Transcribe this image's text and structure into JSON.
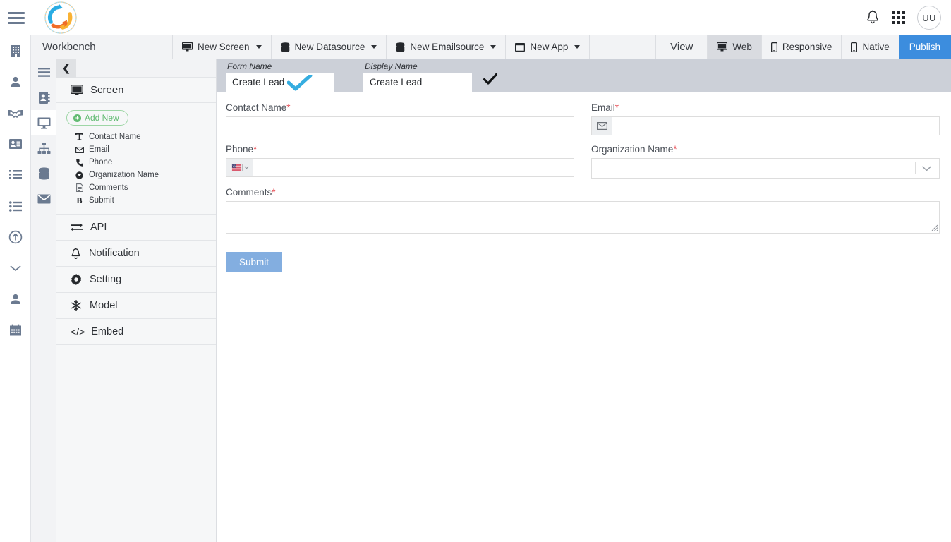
{
  "header": {
    "menu_icon": "hamburger-icon",
    "logo_icon": "sync-refresh-logo",
    "notifications_icon": "bell-icon",
    "apps_icon": "app-grid-icon",
    "avatar_initials": "UU"
  },
  "app_rail": {
    "items": [
      {
        "icon": "building-icon",
        "name": "organizations"
      },
      {
        "icon": "user-icon",
        "name": "contacts"
      },
      {
        "icon": "handshake-icon",
        "name": "deals"
      },
      {
        "icon": "id-card-icon",
        "name": "leads"
      },
      {
        "icon": "list-detail-icon",
        "name": "activities"
      },
      {
        "icon": "list-bullet-icon",
        "name": "tasks"
      },
      {
        "icon": "upload-circle-icon",
        "name": "upload"
      },
      {
        "icon": "chevron-down-icon",
        "name": "more"
      },
      {
        "icon": "user-solid-icon",
        "name": "profile"
      },
      {
        "icon": "calendar-icon",
        "name": "calendar"
      }
    ]
  },
  "tool_rail": {
    "items": [
      {
        "icon": "hamburger-icon",
        "name": "menu",
        "active": false
      },
      {
        "icon": "address-book-icon",
        "name": "contacts-source",
        "active": false
      },
      {
        "icon": "monitor-icon",
        "name": "screen",
        "active": true
      },
      {
        "icon": "sitemap-icon",
        "name": "workflow",
        "active": false
      },
      {
        "icon": "database-icon",
        "name": "datasource",
        "active": false
      },
      {
        "icon": "envelope-icon",
        "name": "emailsource",
        "active": false
      }
    ]
  },
  "toolbar": {
    "title": "Workbench",
    "buttons": [
      {
        "label": "New Screen",
        "icon": "monitor-icon",
        "caret": true
      },
      {
        "label": "New Datasource",
        "icon": "database-icon",
        "caret": true
      },
      {
        "label": "New Emailsource",
        "icon": "database-icon",
        "caret": true
      },
      {
        "label": "New App",
        "icon": "window-icon",
        "caret": true
      }
    ],
    "view_label": "View",
    "view_modes": [
      {
        "label": "Web",
        "icon": "monitor-icon",
        "active": true
      },
      {
        "label": "Responsive",
        "icon": "mobile-icon",
        "active": false
      },
      {
        "label": "Native",
        "icon": "mobile-icon",
        "active": false
      }
    ],
    "publish_label": "Publish",
    "publish_color": "#3c8dde"
  },
  "panel": {
    "collapse_icon": "chevron-left-icon",
    "section_title": "Screen",
    "section_icon": "monitor-icon",
    "add_new_label": "Add New",
    "add_new_color": "#63bb73",
    "fields": [
      {
        "label": "Contact Name",
        "icon": "text-input-icon",
        "glyph": "T"
      },
      {
        "label": "Email",
        "icon": "envelope-icon",
        "glyph": "✉"
      },
      {
        "label": "Phone",
        "icon": "phone-icon",
        "glyph": "☎"
      },
      {
        "label": "Organization Name",
        "icon": "dropdown-circle-icon",
        "glyph": "▼"
      },
      {
        "label": "Comments",
        "icon": "document-icon",
        "glyph": "☷"
      },
      {
        "label": "Submit",
        "icon": "button-bold-icon",
        "glyph": "B"
      }
    ],
    "sections": [
      {
        "label": "API",
        "icon": "exchange-arrows-icon"
      },
      {
        "label": "Notification",
        "icon": "bell-icon"
      },
      {
        "label": "Setting",
        "icon": "gear-icon"
      },
      {
        "label": "Model",
        "icon": "snowflake-icon"
      },
      {
        "label": "Embed",
        "icon": "code-brackets-icon"
      }
    ]
  },
  "canvas": {
    "meta": {
      "form_name_label": "Form Name",
      "form_name_value": "Create Lead",
      "display_name_label": "Display Name",
      "display_name_value": "Create Lead",
      "validated_icon": "blue-checkmark-icon",
      "confirm_icon": "black-checkmark-icon",
      "bar_color": "#ccd0d8"
    },
    "form": {
      "required_marker": "*",
      "required_color": "#e8535a",
      "fields": [
        {
          "label": "Contact Name",
          "required": true,
          "type": "text",
          "value": "",
          "placeholder": "",
          "name": "contact-name"
        },
        {
          "label": "Email",
          "required": true,
          "type": "text-addon",
          "addon_icon": "envelope-icon",
          "value": "",
          "placeholder": "",
          "name": "email"
        },
        {
          "label": "Phone",
          "required": true,
          "type": "phone",
          "addon_icon": "us-flag-icon",
          "value": "",
          "placeholder": "",
          "name": "phone"
        },
        {
          "label": "Organization Name",
          "required": true,
          "type": "select",
          "value": "",
          "placeholder": "",
          "name": "organization-name"
        },
        {
          "label": "Comments",
          "required": true,
          "type": "textarea",
          "value": "",
          "placeholder": "",
          "name": "comments"
        }
      ],
      "submit_label": "Submit",
      "submit_color": "#83aee0"
    }
  }
}
